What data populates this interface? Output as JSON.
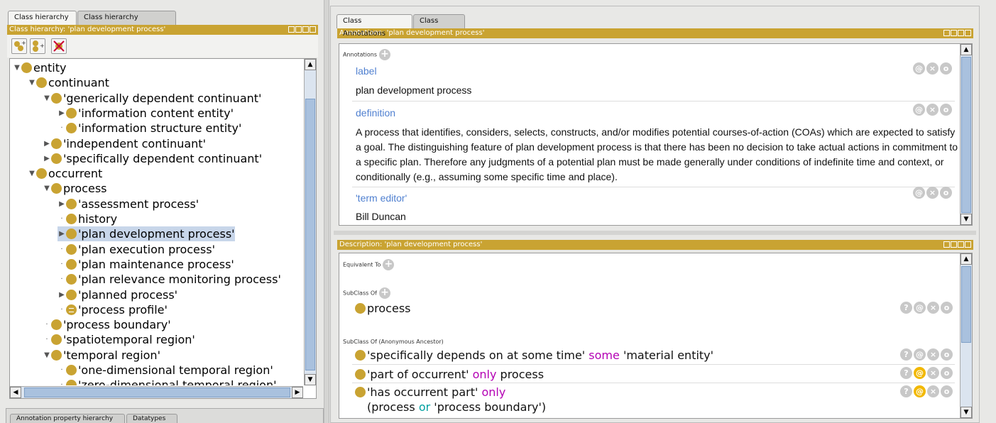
{
  "left_tabs": {
    "tab1": "Class hierarchy",
    "tab2": "Class hierarchy (inferred)"
  },
  "left_header": "Class hierarchy: 'plan development process'",
  "toolbar": {
    "add_subclass": "add-subclass-icon",
    "add_sibling": "add-sibling-icon",
    "delete": "delete-class-icon"
  },
  "tree": [
    {
      "label": "entity",
      "exp": "open"
    },
    {
      "label": "continuant",
      "exp": "open"
    },
    {
      "label": "'generically dependent continuant'",
      "exp": "open"
    },
    {
      "label": "'information content entity'",
      "exp": "closed"
    },
    {
      "label": "'information structure entity'",
      "exp": "none"
    },
    {
      "label": "'independent continuant'",
      "exp": "closed"
    },
    {
      "label": "'specifically dependent continuant'",
      "exp": "closed"
    },
    {
      "label": "occurrent",
      "exp": "open"
    },
    {
      "label": "process",
      "exp": "open"
    },
    {
      "label": "'assessment process'",
      "exp": "closed"
    },
    {
      "label": "history",
      "exp": "none"
    },
    {
      "label": "'plan development process'",
      "exp": "closed",
      "selected": true
    },
    {
      "label": "'plan execution process'",
      "exp": "none"
    },
    {
      "label": "'plan maintenance process'",
      "exp": "none"
    },
    {
      "label": "'plan relevance monitoring process'",
      "exp": "none"
    },
    {
      "label": "'planned process'",
      "exp": "closed"
    },
    {
      "label": "'process profile'",
      "exp": "none",
      "defined": true
    },
    {
      "label": "'process boundary'",
      "exp": "none"
    },
    {
      "label": "'spatiotemporal region'",
      "exp": "none"
    },
    {
      "label": "'temporal region'",
      "exp": "open"
    },
    {
      "label": "'one-dimensional temporal region'",
      "exp": "none"
    },
    {
      "label": "'zero-dimensional temporal region'",
      "exp": "none"
    }
  ],
  "bottom_tabs": {
    "tab1": "Annotation property hierarchy",
    "tab2": "Datatypes"
  },
  "right_tabs": {
    "tab1": "Class Annotations",
    "tab2": "Class Usage"
  },
  "annotations_header": "Annotations: 'plan development process'",
  "annotations_section": "Annotations",
  "annotations": {
    "label_key": "label",
    "label_val": "plan development process",
    "def_key": "definition",
    "def_val": "A process that identifies, considers, selects, constructs, and/or modifies potential courses-of-action (COAs) which are expected to satisfy a goal.  The distinguishing feature of plan development process is that there has been no decision to take actual actions in commitment to a specific plan. Therefore any judgments of a potential plan must be made generally under conditions of indefinite time and context, or conditionally (e.g., assuming some specific time and place).",
    "editor_key": "'term editor'",
    "editor_val": "Bill Duncan"
  },
  "description_header": "Description: 'plan development process'",
  "description": {
    "equiv": "Equivalent To",
    "subclass": "SubClass Of",
    "subclass_item": "process",
    "anon": "SubClass Of (Anonymous Ancestor)",
    "ax1_a": "'specifically depends on at some time'",
    "ax1_kw": "some",
    "ax1_b": "'material entity'",
    "ax2_a": "'part of occurrent'",
    "ax2_kw": "only",
    "ax2_b": "process",
    "ax3_a": "'has occurrent part'",
    "ax3_kw": "only",
    "ax3_l2_open": "(process",
    "ax3_l2_or": "or",
    "ax3_l2_rest": "'process boundary')"
  },
  "icon_glyphs": {
    "at": "@",
    "x": "×",
    "o": "o",
    "q": "?"
  }
}
